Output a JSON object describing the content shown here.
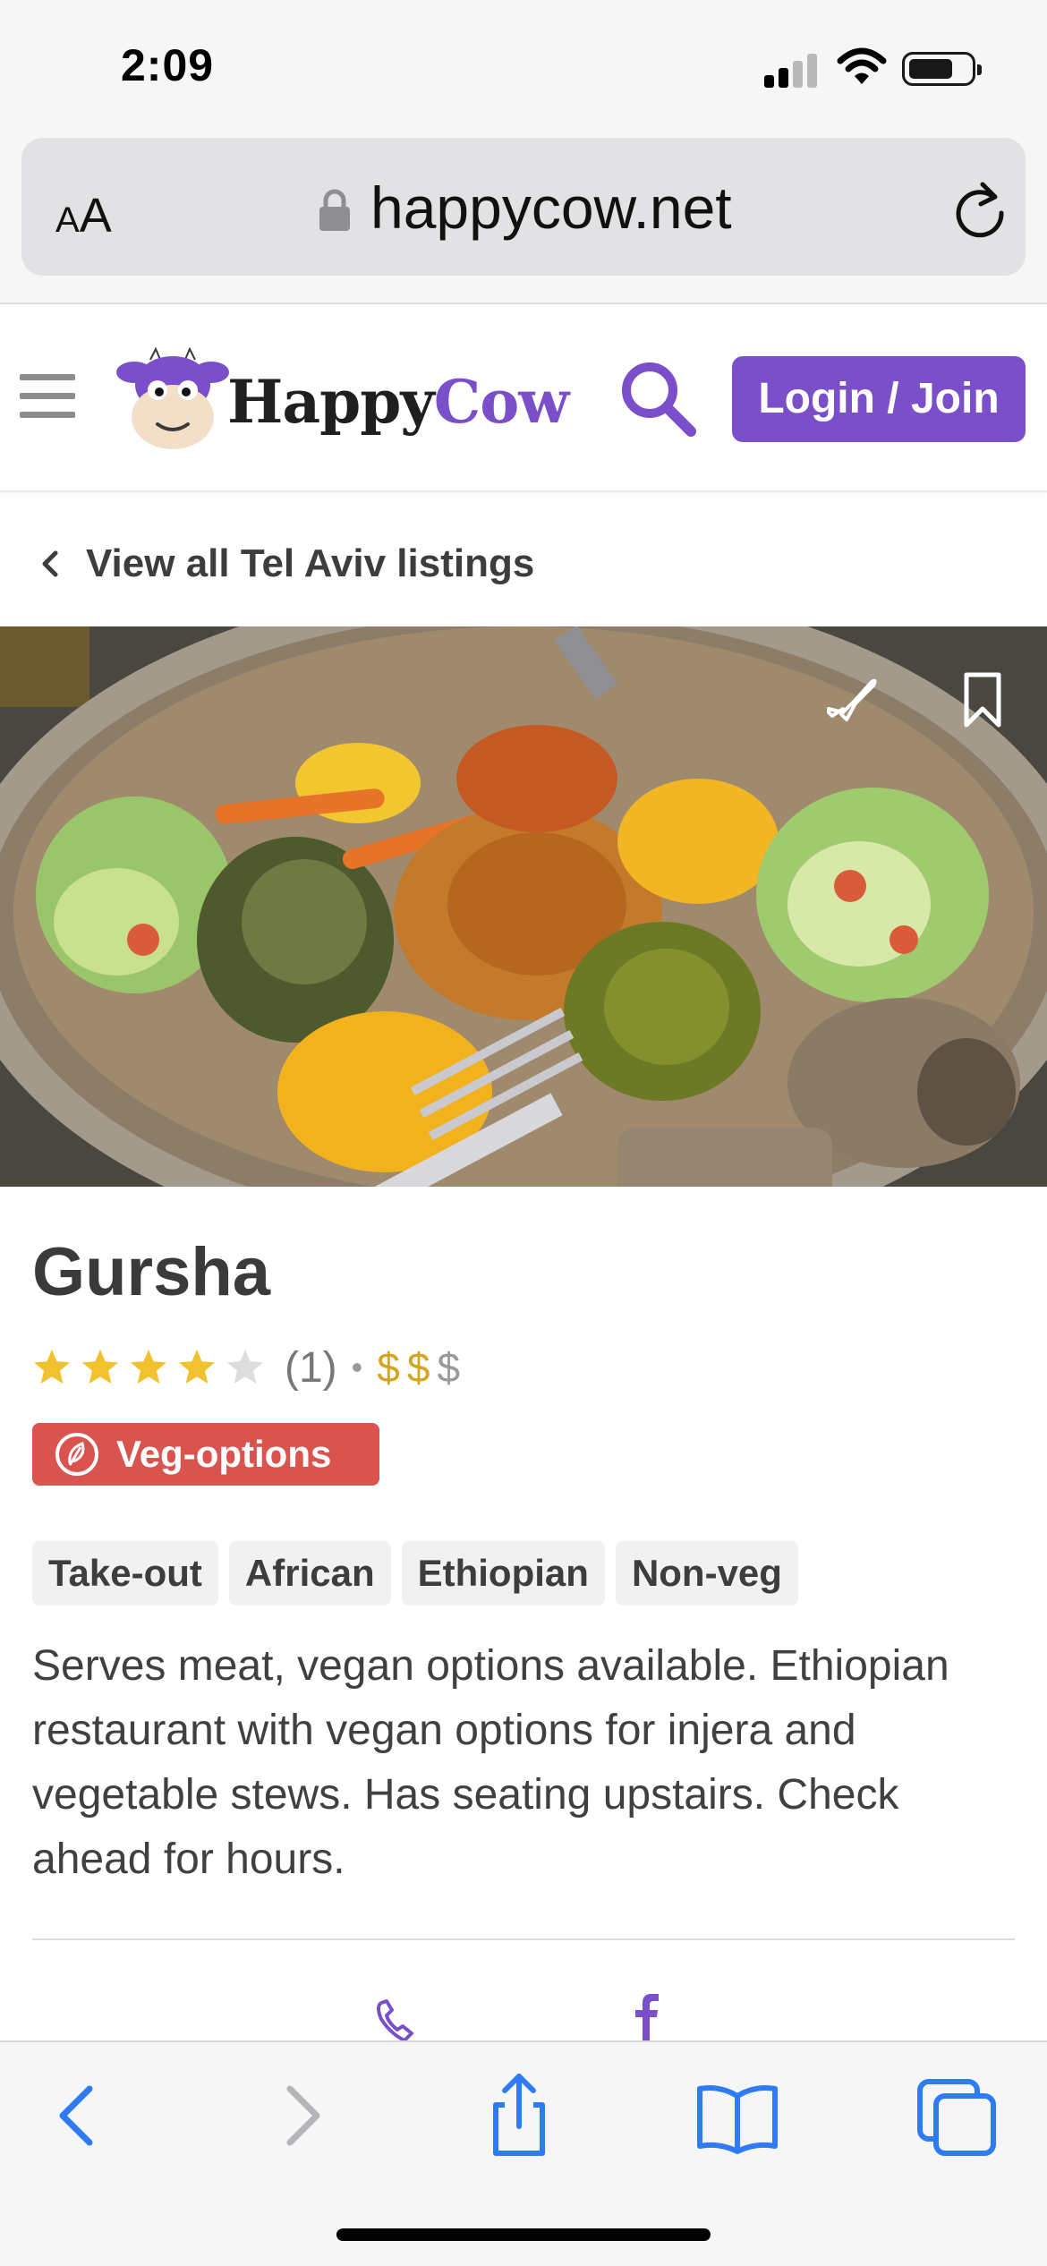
{
  "status_bar": {
    "time": "2:09"
  },
  "browser": {
    "text_size_label_small": "A",
    "text_size_label_large": "A",
    "url": "happycow.net"
  },
  "header": {
    "logo_happy": "Happy",
    "logo_cow": "Cow",
    "login_label": "Login / Join"
  },
  "breadcrumb": {
    "label": "View all Tel Aviv listings"
  },
  "listing": {
    "name": "Gursha",
    "rating": 4,
    "rating_max": 5,
    "review_count": "(1)",
    "separator": "•",
    "price_symbols": [
      "$",
      "$",
      "$"
    ],
    "price_level": 2,
    "category_badge": "Veg-options",
    "tags": [
      "Take-out",
      "African",
      "Ethiopian",
      "Non-veg"
    ],
    "description": "Serves meat, vegan options available. Ethiopian restaurant with vegan options for injera and vegetable stews. Has seating upstairs. Check ahead for hours."
  },
  "colors": {
    "brand_purple": "#7a4fc9",
    "veg_badge_red": "#d9534f",
    "star_gold": "#f2c12e",
    "star_empty": "#dddddd",
    "price_active": "#d4a520",
    "price_inactive": "#9a9a9a",
    "ios_blue": "#2f7bf5"
  },
  "icons": {
    "status": [
      "signal-icon",
      "wifi-icon",
      "battery-icon"
    ],
    "browser": [
      "lock-icon",
      "reload-icon"
    ],
    "header": [
      "menu-icon",
      "cow-logo-icon",
      "search-icon"
    ],
    "hero": [
      "plane-icon",
      "bookmark-icon"
    ],
    "contact": [
      "phone-icon",
      "facebook-icon"
    ],
    "toolbar": [
      "back-icon",
      "forward-icon",
      "share-icon",
      "bookmarks-icon",
      "tabs-icon"
    ]
  }
}
